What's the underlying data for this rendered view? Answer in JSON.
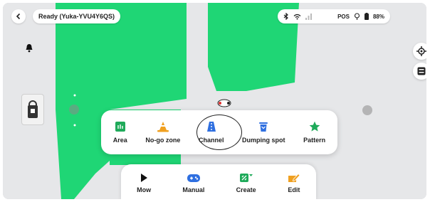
{
  "status": {
    "ready_text": "Ready  (Yuka-YVU4Y6QS)",
    "network_label": "POS",
    "battery_text": "88%"
  },
  "popup": {
    "items": [
      {
        "label": "Area",
        "icon": "area-icon"
      },
      {
        "label": "No-go zone",
        "icon": "traffic-cone-icon"
      },
      {
        "label": "Channel",
        "icon": "channel-icon"
      },
      {
        "label": "Dumping spot",
        "icon": "trash-bin-icon"
      },
      {
        "label": "Pattern",
        "icon": "star-icon"
      }
    ]
  },
  "bottom_nav": {
    "items": [
      {
        "label": "Mow",
        "icon": "play-icon"
      },
      {
        "label": "Manual",
        "icon": "gamepad-icon"
      },
      {
        "label": "Create",
        "icon": "create-icon"
      },
      {
        "label": "Edit",
        "icon": "edit-icon"
      }
    ]
  },
  "colors": {
    "lawn": "#1fd675",
    "accent_green": "#1faa5a",
    "accent_blue": "#2f6fe0",
    "accent_orange": "#f0a020",
    "map_background": "#e6e7e9"
  }
}
